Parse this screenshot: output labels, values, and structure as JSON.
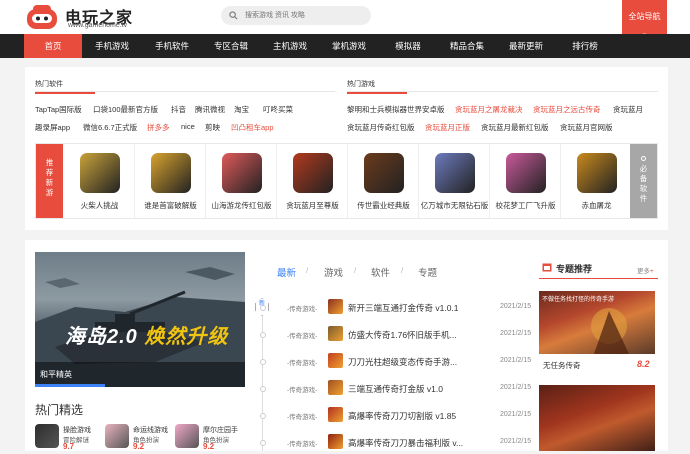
{
  "header": {
    "logo_title": "电玩之家",
    "logo_sub": "www.gamehome.tv",
    "search_placeholder": "搜索游戏 资讯 攻略",
    "site_nav": "全站导航"
  },
  "nav": [
    "首页",
    "手机游戏",
    "手机软件",
    "专区合辑",
    "主机游戏",
    "掌机游戏",
    "模拟器",
    "精品合集",
    "最新更新",
    "排行榜"
  ],
  "hot_software": {
    "title": "热门软件",
    "links": [
      {
        "text": "TapTap国际版",
        "red": false
      },
      {
        "text": "口袋100最新官方版",
        "red": false
      },
      {
        "text": "抖音",
        "red": false
      },
      {
        "text": "腾讯微视",
        "red": false
      },
      {
        "text": "淘宝",
        "red": false
      },
      {
        "text": "叮咚买菜",
        "red": false
      },
      {
        "text": "趣录屏app",
        "red": false
      },
      {
        "text": "微信6.6.7正式版",
        "red": false
      },
      {
        "text": "拼多多",
        "red": true
      },
      {
        "text": "nice",
        "red": false
      },
      {
        "text": "剪映",
        "red": false
      },
      {
        "text": "凹凸租车app",
        "red": true
      }
    ]
  },
  "hot_games": {
    "title": "热门游戏",
    "links": [
      {
        "text": "黎明和士兵模拟器世界安卓版",
        "red": false
      },
      {
        "text": "贪玩蓝月之屠龙裁决",
        "red": true
      },
      {
        "text": "贪玩蓝月之远古传奇",
        "red": true
      },
      {
        "text": "贪玩蓝月",
        "red": false
      },
      {
        "text": "贪玩蓝月传奇红包版",
        "red": false
      },
      {
        "text": "贪玩蓝月正版",
        "red": true
      },
      {
        "text": "贪玩蓝月最新红包版",
        "red": false
      },
      {
        "text": "贪玩蓝月官网版",
        "red": false
      }
    ]
  },
  "strip": {
    "left_label": "推荐新游",
    "right_label": "必备软件",
    "apps": [
      {
        "name": "火柴人挑战",
        "color": "#c9a33a"
      },
      {
        "name": "谁是首富破解版",
        "color": "#d9a42e"
      },
      {
        "name": "山海游龙传红包版",
        "color": "#e05a5a"
      },
      {
        "name": "贪玩蓝月至尊版",
        "color": "#b23a1e"
      },
      {
        "name": "传世霸业经典版",
        "color": "#6b3b1c"
      },
      {
        "name": "亿万城市无限钻石版",
        "color": "#6c7bbd"
      },
      {
        "name": "校花梦工厂飞升版",
        "color": "#c95a9b"
      },
      {
        "name": "赤血屠龙",
        "color": "#c98a1e"
      }
    ]
  },
  "hero": {
    "title_a": "海岛2.0",
    "title_b": "焕然升级",
    "caption": "和平精英"
  },
  "hot_picks": {
    "title": "热门精选",
    "items": [
      {
        "name": "操脸游戏",
        "cat": "冒险解谜",
        "score": "9.7",
        "color": "#2d2d2d"
      },
      {
        "name": "命运线游戏",
        "cat": "角色扮演",
        "score": "9.2",
        "color": "#e8b4c0"
      },
      {
        "name": "摩尔庄园手",
        "cat": "角色扮演",
        "score": "9.2",
        "color": "#f0a8c8"
      }
    ]
  },
  "tabs": [
    "最新",
    "游戏",
    "软件",
    "专题"
  ],
  "timeline_badge": "新",
  "news": [
    {
      "cat": "-传奇游戏-",
      "title": "新开三端互通打金传奇 v1.0.1",
      "date": "2021/2/15",
      "color": "#8a3020"
    },
    {
      "cat": "-传奇游戏-",
      "title": "仿盛大传奇1.76怀旧版手机...",
      "date": "2021/2/15",
      "color": "#7a5a30"
    },
    {
      "cat": "-传奇游戏-",
      "title": "刀刀光柱超级变态传奇手游...",
      "date": "2021/2/15",
      "color": "#c04020"
    },
    {
      "cat": "-传奇游戏-",
      "title": "三端互通传奇打金版 v1.0",
      "date": "2021/2/15",
      "color": "#a05020"
    },
    {
      "cat": "-传奇游戏-",
      "title": "高爆率传奇刀刀切割版 v1.85",
      "date": "2021/2/15",
      "color": "#b03020"
    },
    {
      "cat": "-传奇游戏-",
      "title": "高爆率传奇刀刀暴击福利版 v...",
      "date": "2021/2/15",
      "color": "#902010"
    }
  ],
  "topic": {
    "title": "专题推荐",
    "more": "更多",
    "card_text": "不做任务找打怪的传奇手游",
    "name": "无任务传奇",
    "score": "8.2"
  },
  "colors": {
    "accent": "#e84c3d",
    "nav_bg": "#222222",
    "link_blue": "#3b82f6"
  }
}
